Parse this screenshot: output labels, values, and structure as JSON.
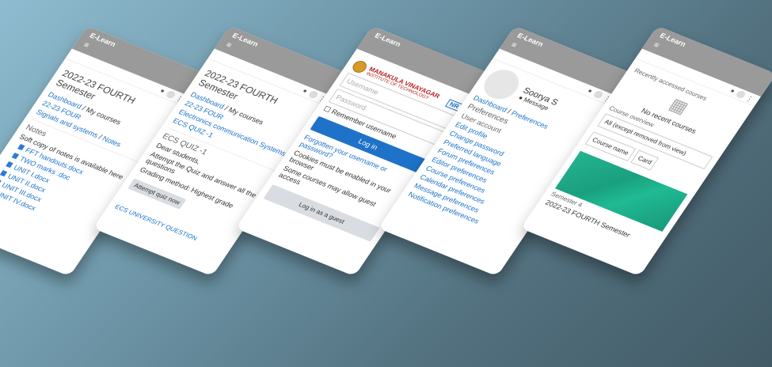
{
  "brand": "E-Learn",
  "menu_icon": "≡",
  "phone1": {
    "title": "2022-23 FOURTH Semester",
    "breadcrumb": [
      "Dashboard",
      "My courses",
      "22-23 FOUR",
      "Signals and systems",
      "Notes"
    ],
    "heading": "Notes",
    "intro": "Soft copy of notes is available here",
    "files": [
      "FFT handouts.docx",
      "TWO marks .doc",
      "UNIT I.docx",
      "UNIT II.docx",
      "UNIT III.docx",
      "UNIT IV.docx"
    ]
  },
  "phone2": {
    "title": "2022-23 FOURTH Semester",
    "breadcrumb": [
      "Dashboard",
      "My courses",
      "22-23 FOUR",
      "Electronics communication Systems",
      "ECS QUIZ -1"
    ],
    "quiz_title": "ECS QUIZ -1",
    "greeting": "Dear students,",
    "instruction": "Attempt the Quiz and answer all the questions",
    "grading": "Grading method: Highest grade",
    "attempt_button": "Attempt quiz now",
    "footer_link": "ECS UNIVERSITY QUESTION"
  },
  "phone3": {
    "logo_name": "MANAKULA VINAYAGAR",
    "logo_sub": "INSTITUTE OF TECHNOLOGY",
    "logo_nr": "NR",
    "username_placeholder": "Username",
    "password_placeholder": "Password",
    "remember": "Remember username",
    "login_button": "Log in",
    "forgot": "Forgotten your username or password?",
    "cookies": "Cookies must be enabled in your browser",
    "guest_note": "Some courses may allow guest access",
    "guest_button": "Log in as a guest"
  },
  "phone4": {
    "user_name": "Soorya S",
    "message": "Message",
    "breadcrumb": [
      "Dashboard",
      "Preferences"
    ],
    "heading": "Preferences",
    "section": "User account",
    "items": [
      "Edit profile",
      "Change password",
      "Preferred language",
      "Forum preferences",
      "Editor preferences",
      "Course preferences",
      "Calendar preferences",
      "Message preferences",
      "Notification preferences"
    ]
  },
  "phone5": {
    "recent_heading": "Recently accessed courses",
    "no_recent": "No recent courses",
    "overview_heading": "Course overview",
    "filter": "All (except removed from view)",
    "sort": "Course name",
    "view": "Card",
    "course_category": "Semester 4",
    "course_name": "2022-23 FOURTH Semester"
  },
  "colors": {
    "accent": "#1a73c9",
    "topbar": "#9a9a9a",
    "tile": "#1fba93"
  }
}
